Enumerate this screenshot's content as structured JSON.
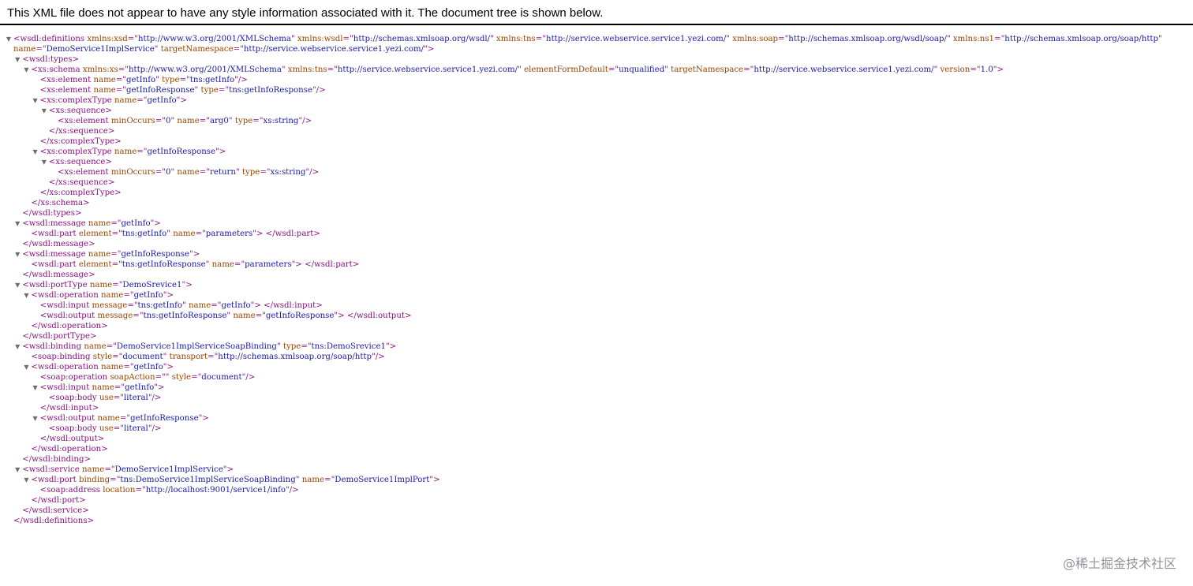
{
  "banner": {
    "text": "This XML file does not appear to have any style information associated with it. The document tree is shown below."
  },
  "xml_lines": [
    {
      "indent": 0,
      "fold": true,
      "segs": [
        [
          "t",
          "<wsdl:definitions "
        ],
        [
          "a",
          "xmlns:xsd"
        ],
        [
          "t",
          "=\""
        ],
        [
          "v",
          "http://www.w3.org/2001/XMLSchema"
        ],
        [
          "t",
          "\" "
        ],
        [
          "a",
          "xmlns:wsdl"
        ],
        [
          "t",
          "=\""
        ],
        [
          "v",
          "http://schemas.xmlsoap.org/wsdl/"
        ],
        [
          "t",
          "\" "
        ],
        [
          "a",
          "xmlns:tns"
        ],
        [
          "t",
          "=\""
        ],
        [
          "v",
          "http://service.webservice.service1.yezi.com/"
        ],
        [
          "t",
          "\" "
        ],
        [
          "a",
          "xmlns:soap"
        ],
        [
          "t",
          "=\""
        ],
        [
          "v",
          "http://schemas.xmlsoap.org/wsdl/soap/"
        ],
        [
          "t",
          "\" "
        ],
        [
          "a",
          "xmlns:ns1"
        ],
        [
          "t",
          "=\""
        ],
        [
          "v",
          "http://schemas.xmlsoap.org/soap/http"
        ],
        [
          "t",
          "\""
        ]
      ]
    },
    {
      "indent": 0,
      "fold": false,
      "segs": [
        [
          "a",
          "name"
        ],
        [
          "t",
          "=\""
        ],
        [
          "v",
          "DemoService1ImplService"
        ],
        [
          "t",
          "\" "
        ],
        [
          "a",
          "targetNamespace"
        ],
        [
          "t",
          "=\""
        ],
        [
          "v",
          "http://service.webservice.service1.yezi.com/"
        ],
        [
          "t",
          "\">"
        ]
      ]
    },
    {
      "indent": 1,
      "fold": true,
      "segs": [
        [
          "t",
          "<wsdl:types>"
        ]
      ]
    },
    {
      "indent": 2,
      "fold": true,
      "segs": [
        [
          "t",
          "<xs:schema "
        ],
        [
          "a",
          "xmlns:xs"
        ],
        [
          "t",
          "=\""
        ],
        [
          "v",
          "http://www.w3.org/2001/XMLSchema"
        ],
        [
          "t",
          "\" "
        ],
        [
          "a",
          "xmlns:tns"
        ],
        [
          "t",
          "=\""
        ],
        [
          "v",
          "http://service.webservice.service1.yezi.com/"
        ],
        [
          "t",
          "\" "
        ],
        [
          "a",
          "elementFormDefault"
        ],
        [
          "t",
          "=\""
        ],
        [
          "v",
          "unqualified"
        ],
        [
          "t",
          "\" "
        ],
        [
          "a",
          "targetNamespace"
        ],
        [
          "t",
          "=\""
        ],
        [
          "v",
          "http://service.webservice.service1.yezi.com/"
        ],
        [
          "t",
          "\" "
        ],
        [
          "a",
          "version"
        ],
        [
          "t",
          "=\""
        ],
        [
          "v",
          "1.0"
        ],
        [
          "t",
          "\">"
        ]
      ]
    },
    {
      "indent": 3,
      "fold": false,
      "segs": [
        [
          "t",
          "<xs:element "
        ],
        [
          "a",
          "name"
        ],
        [
          "t",
          "=\""
        ],
        [
          "v",
          "getInfo"
        ],
        [
          "t",
          "\" "
        ],
        [
          "a",
          "type"
        ],
        [
          "t",
          "=\""
        ],
        [
          "v",
          "tns:getInfo"
        ],
        [
          "t",
          "\"/>"
        ]
      ]
    },
    {
      "indent": 3,
      "fold": false,
      "segs": [
        [
          "t",
          "<xs:element "
        ],
        [
          "a",
          "name"
        ],
        [
          "t",
          "=\""
        ],
        [
          "v",
          "getInfoResponse"
        ],
        [
          "t",
          "\" "
        ],
        [
          "a",
          "type"
        ],
        [
          "t",
          "=\""
        ],
        [
          "v",
          "tns:getInfoResponse"
        ],
        [
          "t",
          "\"/>"
        ]
      ]
    },
    {
      "indent": 3,
      "fold": true,
      "segs": [
        [
          "t",
          "<xs:complexType "
        ],
        [
          "a",
          "name"
        ],
        [
          "t",
          "=\""
        ],
        [
          "v",
          "getInfo"
        ],
        [
          "t",
          "\">"
        ]
      ]
    },
    {
      "indent": 4,
      "fold": true,
      "segs": [
        [
          "t",
          "<xs:sequence>"
        ]
      ]
    },
    {
      "indent": 5,
      "fold": false,
      "segs": [
        [
          "t",
          "<xs:element "
        ],
        [
          "a",
          "minOccurs"
        ],
        [
          "t",
          "=\""
        ],
        [
          "v",
          "0"
        ],
        [
          "t",
          "\" "
        ],
        [
          "a",
          "name"
        ],
        [
          "t",
          "=\""
        ],
        [
          "v",
          "arg0"
        ],
        [
          "t",
          "\" "
        ],
        [
          "a",
          "type"
        ],
        [
          "t",
          "=\""
        ],
        [
          "v",
          "xs:string"
        ],
        [
          "t",
          "\"/>"
        ]
      ]
    },
    {
      "indent": 4,
      "fold": false,
      "segs": [
        [
          "t",
          "</xs:sequence>"
        ]
      ]
    },
    {
      "indent": 3,
      "fold": false,
      "segs": [
        [
          "t",
          "</xs:complexType>"
        ]
      ]
    },
    {
      "indent": 3,
      "fold": true,
      "segs": [
        [
          "t",
          "<xs:complexType "
        ],
        [
          "a",
          "name"
        ],
        [
          "t",
          "=\""
        ],
        [
          "v",
          "getInfoResponse"
        ],
        [
          "t",
          "\">"
        ]
      ]
    },
    {
      "indent": 4,
      "fold": true,
      "segs": [
        [
          "t",
          "<xs:sequence>"
        ]
      ]
    },
    {
      "indent": 5,
      "fold": false,
      "segs": [
        [
          "t",
          "<xs:element "
        ],
        [
          "a",
          "minOccurs"
        ],
        [
          "t",
          "=\""
        ],
        [
          "v",
          "0"
        ],
        [
          "t",
          "\" "
        ],
        [
          "a",
          "name"
        ],
        [
          "t",
          "=\""
        ],
        [
          "v",
          "return"
        ],
        [
          "t",
          "\" "
        ],
        [
          "a",
          "type"
        ],
        [
          "t",
          "=\""
        ],
        [
          "v",
          "xs:string"
        ],
        [
          "t",
          "\"/>"
        ]
      ]
    },
    {
      "indent": 4,
      "fold": false,
      "segs": [
        [
          "t",
          "</xs:sequence>"
        ]
      ]
    },
    {
      "indent": 3,
      "fold": false,
      "segs": [
        [
          "t",
          "</xs:complexType>"
        ]
      ]
    },
    {
      "indent": 2,
      "fold": false,
      "segs": [
        [
          "t",
          "</xs:schema>"
        ]
      ]
    },
    {
      "indent": 1,
      "fold": false,
      "segs": [
        [
          "t",
          "</wsdl:types>"
        ]
      ]
    },
    {
      "indent": 1,
      "fold": true,
      "segs": [
        [
          "t",
          "<wsdl:message "
        ],
        [
          "a",
          "name"
        ],
        [
          "t",
          "=\""
        ],
        [
          "v",
          "getInfo"
        ],
        [
          "t",
          "\">"
        ]
      ]
    },
    {
      "indent": 2,
      "fold": false,
      "segs": [
        [
          "t",
          "<wsdl:part "
        ],
        [
          "a",
          "element"
        ],
        [
          "t",
          "=\""
        ],
        [
          "v",
          "tns:getInfo"
        ],
        [
          "t",
          "\" "
        ],
        [
          "a",
          "name"
        ],
        [
          "t",
          "=\""
        ],
        [
          "v",
          "parameters"
        ],
        [
          "t",
          "\"> </wsdl:part>"
        ]
      ]
    },
    {
      "indent": 1,
      "fold": false,
      "segs": [
        [
          "t",
          "</wsdl:message>"
        ]
      ]
    },
    {
      "indent": 1,
      "fold": true,
      "segs": [
        [
          "t",
          "<wsdl:message "
        ],
        [
          "a",
          "name"
        ],
        [
          "t",
          "=\""
        ],
        [
          "v",
          "getInfoResponse"
        ],
        [
          "t",
          "\">"
        ]
      ]
    },
    {
      "indent": 2,
      "fold": false,
      "segs": [
        [
          "t",
          "<wsdl:part "
        ],
        [
          "a",
          "element"
        ],
        [
          "t",
          "=\""
        ],
        [
          "v",
          "tns:getInfoResponse"
        ],
        [
          "t",
          "\" "
        ],
        [
          "a",
          "name"
        ],
        [
          "t",
          "=\""
        ],
        [
          "v",
          "parameters"
        ],
        [
          "t",
          "\"> </wsdl:part>"
        ]
      ]
    },
    {
      "indent": 1,
      "fold": false,
      "segs": [
        [
          "t",
          "</wsdl:message>"
        ]
      ]
    },
    {
      "indent": 1,
      "fold": true,
      "segs": [
        [
          "t",
          "<wsdl:portType "
        ],
        [
          "a",
          "name"
        ],
        [
          "t",
          "=\""
        ],
        [
          "v",
          "DemoSrevice1"
        ],
        [
          "t",
          "\">"
        ]
      ]
    },
    {
      "indent": 2,
      "fold": true,
      "segs": [
        [
          "t",
          "<wsdl:operation "
        ],
        [
          "a",
          "name"
        ],
        [
          "t",
          "=\""
        ],
        [
          "v",
          "getInfo"
        ],
        [
          "t",
          "\">"
        ]
      ]
    },
    {
      "indent": 3,
      "fold": false,
      "segs": [
        [
          "t",
          "<wsdl:input "
        ],
        [
          "a",
          "message"
        ],
        [
          "t",
          "=\""
        ],
        [
          "v",
          "tns:getInfo"
        ],
        [
          "t",
          "\" "
        ],
        [
          "a",
          "name"
        ],
        [
          "t",
          "=\""
        ],
        [
          "v",
          "getInfo"
        ],
        [
          "t",
          "\"> </wsdl:input>"
        ]
      ]
    },
    {
      "indent": 3,
      "fold": false,
      "segs": [
        [
          "t",
          "<wsdl:output "
        ],
        [
          "a",
          "message"
        ],
        [
          "t",
          "=\""
        ],
        [
          "v",
          "tns:getInfoResponse"
        ],
        [
          "t",
          "\" "
        ],
        [
          "a",
          "name"
        ],
        [
          "t",
          "=\""
        ],
        [
          "v",
          "getInfoResponse"
        ],
        [
          "t",
          "\"> </wsdl:output>"
        ]
      ]
    },
    {
      "indent": 2,
      "fold": false,
      "segs": [
        [
          "t",
          "</wsdl:operation>"
        ]
      ]
    },
    {
      "indent": 1,
      "fold": false,
      "segs": [
        [
          "t",
          "</wsdl:portType>"
        ]
      ]
    },
    {
      "indent": 1,
      "fold": true,
      "segs": [
        [
          "t",
          "<wsdl:binding "
        ],
        [
          "a",
          "name"
        ],
        [
          "t",
          "=\""
        ],
        [
          "v",
          "DemoService1ImplServiceSoapBinding"
        ],
        [
          "t",
          "\" "
        ],
        [
          "a",
          "type"
        ],
        [
          "t",
          "=\""
        ],
        [
          "v",
          "tns:DemoSrevice1"
        ],
        [
          "t",
          "\">"
        ]
      ]
    },
    {
      "indent": 2,
      "fold": false,
      "segs": [
        [
          "t",
          "<soap:binding "
        ],
        [
          "a",
          "style"
        ],
        [
          "t",
          "=\""
        ],
        [
          "v",
          "document"
        ],
        [
          "t",
          "\" "
        ],
        [
          "a",
          "transport"
        ],
        [
          "t",
          "=\""
        ],
        [
          "v",
          "http://schemas.xmlsoap.org/soap/http"
        ],
        [
          "t",
          "\"/>"
        ]
      ]
    },
    {
      "indent": 2,
      "fold": true,
      "segs": [
        [
          "t",
          "<wsdl:operation "
        ],
        [
          "a",
          "name"
        ],
        [
          "t",
          "=\""
        ],
        [
          "v",
          "getInfo"
        ],
        [
          "t",
          "\">"
        ]
      ]
    },
    {
      "indent": 3,
      "fold": false,
      "segs": [
        [
          "t",
          "<soap:operation "
        ],
        [
          "a",
          "soapAction"
        ],
        [
          "t",
          "=\""
        ],
        [
          "v",
          ""
        ],
        [
          "t",
          "\" "
        ],
        [
          "a",
          "style"
        ],
        [
          "t",
          "=\""
        ],
        [
          "v",
          "document"
        ],
        [
          "t",
          "\"/>"
        ]
      ]
    },
    {
      "indent": 3,
      "fold": true,
      "segs": [
        [
          "t",
          "<wsdl:input "
        ],
        [
          "a",
          "name"
        ],
        [
          "t",
          "=\""
        ],
        [
          "v",
          "getInfo"
        ],
        [
          "t",
          "\">"
        ]
      ]
    },
    {
      "indent": 4,
      "fold": false,
      "segs": [
        [
          "t",
          "<soap:body "
        ],
        [
          "a",
          "use"
        ],
        [
          "t",
          "=\""
        ],
        [
          "v",
          "literal"
        ],
        [
          "t",
          "\"/>"
        ]
      ]
    },
    {
      "indent": 3,
      "fold": false,
      "segs": [
        [
          "t",
          "</wsdl:input>"
        ]
      ]
    },
    {
      "indent": 3,
      "fold": true,
      "segs": [
        [
          "t",
          "<wsdl:output "
        ],
        [
          "a",
          "name"
        ],
        [
          "t",
          "=\""
        ],
        [
          "v",
          "getInfoResponse"
        ],
        [
          "t",
          "\">"
        ]
      ]
    },
    {
      "indent": 4,
      "fold": false,
      "segs": [
        [
          "t",
          "<soap:body "
        ],
        [
          "a",
          "use"
        ],
        [
          "t",
          "=\""
        ],
        [
          "v",
          "literal"
        ],
        [
          "t",
          "\"/>"
        ]
      ]
    },
    {
      "indent": 3,
      "fold": false,
      "segs": [
        [
          "t",
          "</wsdl:output>"
        ]
      ]
    },
    {
      "indent": 2,
      "fold": false,
      "segs": [
        [
          "t",
          "</wsdl:operation>"
        ]
      ]
    },
    {
      "indent": 1,
      "fold": false,
      "segs": [
        [
          "t",
          "</wsdl:binding>"
        ]
      ]
    },
    {
      "indent": 1,
      "fold": true,
      "segs": [
        [
          "t",
          "<wsdl:service "
        ],
        [
          "a",
          "name"
        ],
        [
          "t",
          "=\""
        ],
        [
          "v",
          "DemoService1ImplService"
        ],
        [
          "t",
          "\">"
        ]
      ]
    },
    {
      "indent": 2,
      "fold": true,
      "segs": [
        [
          "t",
          "<wsdl:port "
        ],
        [
          "a",
          "binding"
        ],
        [
          "t",
          "=\""
        ],
        [
          "v",
          "tns:DemoService1ImplServiceSoapBinding"
        ],
        [
          "t",
          "\" "
        ],
        [
          "a",
          "name"
        ],
        [
          "t",
          "=\""
        ],
        [
          "v",
          "DemoService1ImplPort"
        ],
        [
          "t",
          "\">"
        ]
      ]
    },
    {
      "indent": 3,
      "fold": false,
      "segs": [
        [
          "t",
          "<soap:address "
        ],
        [
          "a",
          "location"
        ],
        [
          "t",
          "=\""
        ],
        [
          "v",
          "http://localhost:9001/service1/info"
        ],
        [
          "t",
          "\"/>"
        ]
      ]
    },
    {
      "indent": 2,
      "fold": false,
      "segs": [
        [
          "t",
          "</wsdl:port>"
        ]
      ]
    },
    {
      "indent": 1,
      "fold": false,
      "segs": [
        [
          "t",
          "</wsdl:service>"
        ]
      ]
    },
    {
      "indent": 0,
      "fold": false,
      "segs": [
        [
          "t",
          "</wsdl:definitions>"
        ]
      ]
    }
  ],
  "watermark": {
    "text": "@稀土掘金技术社区"
  },
  "icons": {
    "fold_arrow": "triangle-down-icon",
    "fold_glyph": "▼"
  },
  "colors": {
    "tag": "#881280",
    "attribute": "#994500",
    "value": "#1a1aa6",
    "banner_rule": "#000000",
    "watermark": "#8f9399"
  }
}
